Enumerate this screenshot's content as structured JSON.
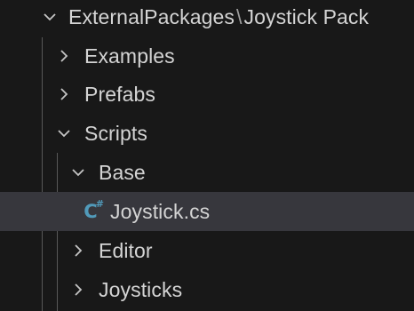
{
  "explorer": {
    "root": {
      "label_left": "ExternalPackages",
      "separator": "\\",
      "label_right": "Joystick Pack",
      "expanded": true
    },
    "items": [
      {
        "label": "Examples",
        "expanded": false,
        "depth": 1,
        "type": "folder"
      },
      {
        "label": "Prefabs",
        "expanded": false,
        "depth": 1,
        "type": "folder"
      },
      {
        "label": "Scripts",
        "expanded": true,
        "depth": 1,
        "type": "folder"
      },
      {
        "label": "Base",
        "expanded": true,
        "depth": 2,
        "type": "folder"
      },
      {
        "label": "Joystick.cs",
        "depth": 3,
        "type": "file",
        "selected": true,
        "icon": "csharp-file-icon"
      },
      {
        "label": "Editor",
        "expanded": false,
        "depth": 2,
        "type": "folder"
      },
      {
        "label": "Joysticks",
        "expanded": false,
        "depth": 2,
        "type": "folder"
      }
    ]
  },
  "colors": {
    "background": "#181818",
    "selected_row": "#37373d",
    "text": "#d4d4d4",
    "guide": "#585858",
    "csharp_icon": "#519aba"
  }
}
